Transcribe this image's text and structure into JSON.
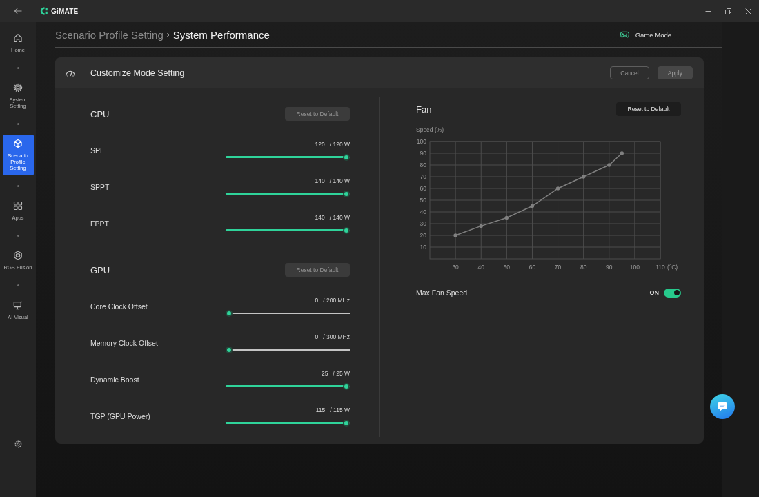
{
  "window": {
    "app_name": "GiMATE"
  },
  "sidebar": {
    "items": [
      {
        "label": "Home",
        "selected": false
      },
      {
        "label": "System Setting",
        "selected": false
      },
      {
        "label": "Scenario Profile Setting",
        "selected": true
      },
      {
        "label": "Apps",
        "selected": false
      },
      {
        "label": "RGB Fusion",
        "selected": false
      },
      {
        "label": "AI Visual",
        "selected": false
      }
    ]
  },
  "breadcrumb": {
    "items": [
      {
        "label": "Scenario Profile Setting",
        "current": false
      },
      {
        "label": "System Performance",
        "current": true
      }
    ],
    "separator": "›"
  },
  "mode": {
    "label": "Game Mode"
  },
  "panel": {
    "title": "Customize Mode Setting",
    "buttons": [
      {
        "label": "Cancel",
        "disabled": false
      },
      {
        "label": "Apply",
        "disabled": true
      }
    ],
    "sections": [
      {
        "title": "CPU",
        "reset": {
          "label": "Reset to Default",
          "disabled": true
        },
        "sliders": [
          {
            "label": "SPL",
            "value": "120",
            "max": "/ 120 W",
            "level": 1
          },
          {
            "label": "SPPT",
            "value": "140",
            "max": "/ 140 W",
            "level": 1
          },
          {
            "label": "FPPT",
            "value": "140",
            "max": "/ 140 W",
            "level": 1
          }
        ]
      },
      {
        "title": "GPU",
        "reset": {
          "label": "Reset to Default",
          "disabled": true
        },
        "sliders": [
          {
            "label": "Core Clock Offset",
            "value": "0",
            "max": "/ 200 MHz",
            "level": 0
          },
          {
            "label": "Memory Clock Offset",
            "value": "0",
            "max": "/ 300 MHz",
            "level": 0
          },
          {
            "label": "Dynamic Boost",
            "value": "25",
            "max": "/ 25 W",
            "level": 1
          },
          {
            "label": "TGP (GPU Power)",
            "value": "115",
            "max": "/ 115 W",
            "level": 1
          }
        ]
      }
    ],
    "fan": {
      "title": "Fan",
      "reset": {
        "label": "Reset to Default",
        "disabled": false
      },
      "chart_data": {
        "type": "line",
        "ylabel": "Speed (%)",
        "xlabel": "(°C)",
        "x": [
          30,
          40,
          50,
          60,
          70,
          80,
          90,
          95
        ],
        "series": [
          {
            "color": "#808080",
            "values": [
              20,
              28,
              35,
              45,
              60,
              70,
              80,
              90
            ]
          }
        ],
        "xlim": [
          20,
          110
        ],
        "ylim": [
          0,
          100
        ],
        "xticks": [
          30,
          40,
          50,
          60,
          70,
          80,
          90,
          100,
          110
        ],
        "yticks": [
          10,
          20,
          30,
          40,
          50,
          60,
          70,
          80,
          90,
          100
        ],
        "grid": true
      },
      "max_fan_speed": {
        "label": "Max Fan Speed",
        "state_text": "ON",
        "on": true
      }
    }
  }
}
